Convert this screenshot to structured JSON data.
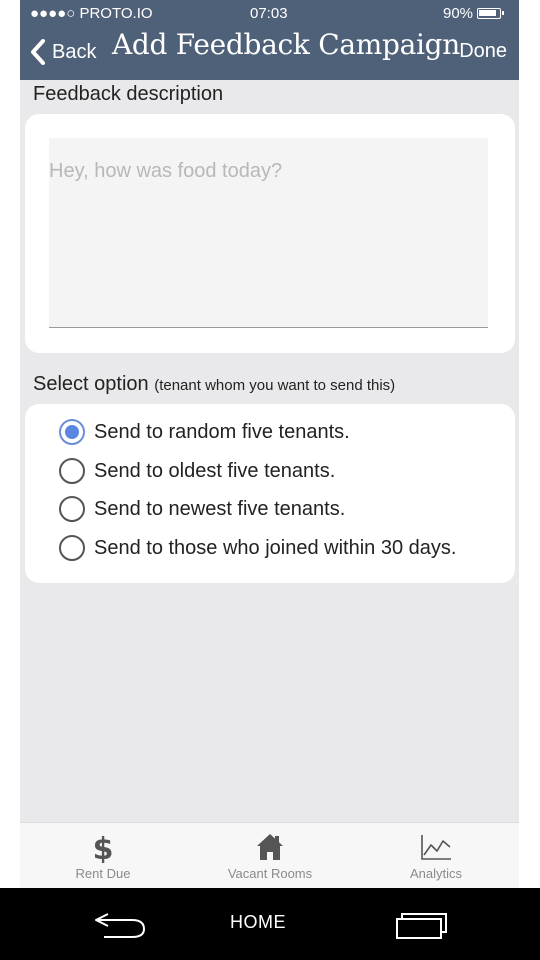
{
  "status_bar": {
    "carrier": "●●●●○ PROTO.IO",
    "time": "07:03",
    "battery": "90%"
  },
  "nav": {
    "back_label": "Back",
    "title": "Add Feedback Campaign",
    "done_label": "Done"
  },
  "description": {
    "label": "Feedback description",
    "placeholder": "Hey, how was food today?",
    "value": ""
  },
  "options": {
    "label": "Select option",
    "note": "(tenant whom you want to send this)",
    "items": [
      {
        "label": "Send to random five tenants.",
        "selected": true
      },
      {
        "label": "Send to oldest five tenants.",
        "selected": false
      },
      {
        "label": "Send to newest five tenants.",
        "selected": false
      },
      {
        "label": "Send to those who joined within 30 days.",
        "selected": false
      }
    ]
  },
  "tabbar": {
    "tabs": [
      {
        "label": "Rent Due",
        "icon": "dollar-icon"
      },
      {
        "label": "Vacant Rooms",
        "icon": "house-icon"
      },
      {
        "label": "Analytics",
        "icon": "line-chart-icon"
      }
    ]
  },
  "system_nav": {
    "home_label": "HOME",
    "back_icon": "back-arrow-icon",
    "recents_icon": "recent-apps-icon"
  },
  "colors": {
    "header_bg": "#4f6178",
    "screen_bg": "#e9e9eb",
    "radio_selected": "#5b87e0",
    "tab_label": "#8a8a8a"
  }
}
